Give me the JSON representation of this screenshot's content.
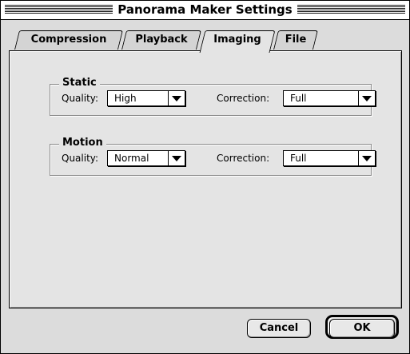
{
  "window": {
    "title": "Panorama Maker Settings"
  },
  "tabs": [
    {
      "label": "Compression",
      "active": false
    },
    {
      "label": "Playback",
      "active": false
    },
    {
      "label": "Imaging",
      "active": true
    },
    {
      "label": "File",
      "active": false
    }
  ],
  "static_group": {
    "label": "Static",
    "quality_label": "Quality:",
    "quality_value": "High",
    "correction_label": "Correction:",
    "correction_value": "Full"
  },
  "motion_group": {
    "label": "Motion",
    "quality_label": "Quality:",
    "quality_value": "Normal",
    "correction_label": "Correction:",
    "correction_value": "Full"
  },
  "buttons": {
    "cancel": "Cancel",
    "ok": "OK"
  },
  "icons": {
    "popup_arrow": "chevron-down-icon"
  }
}
